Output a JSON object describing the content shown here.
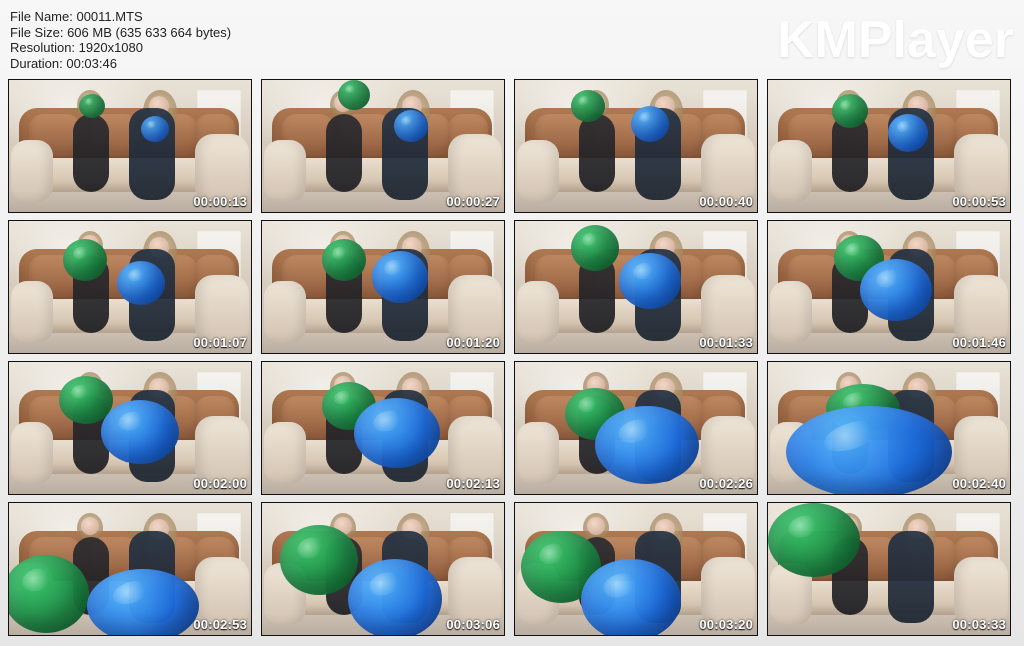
{
  "header": {
    "file_name": "File Name: 00011.MTS",
    "file_size": "File Size: 606 MB (635 633 664 bytes)",
    "resolution": "Resolution: 1920x1080",
    "duration": "Duration: 00:03:46"
  },
  "brand": {
    "text": "KMPlayer"
  },
  "thumbnails": [
    {
      "time": "00:00:13"
    },
    {
      "time": "00:00:27"
    },
    {
      "time": "00:00:40"
    },
    {
      "time": "00:00:53"
    },
    {
      "time": "00:01:07"
    },
    {
      "time": "00:01:20"
    },
    {
      "time": "00:01:33"
    },
    {
      "time": "00:01:46"
    },
    {
      "time": "00:02:00"
    },
    {
      "time": "00:02:13"
    },
    {
      "time": "00:02:26"
    },
    {
      "time": "00:02:40"
    },
    {
      "time": "00:02:53"
    },
    {
      "time": "00:03:06"
    },
    {
      "time": "00:03:20"
    },
    {
      "time": "00:03:33"
    }
  ]
}
